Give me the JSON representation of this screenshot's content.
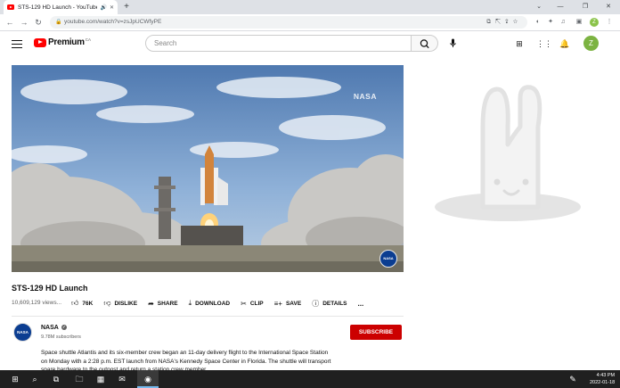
{
  "browser": {
    "tab_title": "STS-129 HD Launch - YouTube",
    "url": "youtube.com/watch?v=zsJpUCWfyPE",
    "new_tab_label": "+",
    "profile_initial": "Z"
  },
  "youtube": {
    "logo_text": "Premium",
    "logo_country": "CA",
    "search_placeholder": "Search",
    "user_initial": "Z"
  },
  "video": {
    "watermark": "NASA",
    "corner_logo": "NASA",
    "title": "STS-129 HD Launch",
    "views": "10,609,129 views...",
    "actions": {
      "like": "76K",
      "dislike": "DISLIKE",
      "share": "SHARE",
      "download": "DOWNLOAD",
      "clip": "CLIP",
      "save": "SAVE",
      "details": "DETAILS",
      "more": "..."
    }
  },
  "channel": {
    "avatar_text": "NASA",
    "name": "NASA",
    "subscribers": "9.78M subscribers",
    "subscribe_label": "SUBSCRIBE"
  },
  "description": "Space shuttle Atlantis and its six-member crew began an 11-day delivery flight to the International Space Station on Monday with a 2:28 p.m. EST launch from NASA's Kennedy Space Center in Florida. The shuttle will transport spare hardware to the outpost and return a station crew member.",
  "taskbar": {
    "time": "4:43 PM",
    "date": "2022-01-18"
  },
  "colors": {
    "brand_red": "#ff0000",
    "subscribe_red": "#cc0000",
    "taskbar": "#202020"
  }
}
